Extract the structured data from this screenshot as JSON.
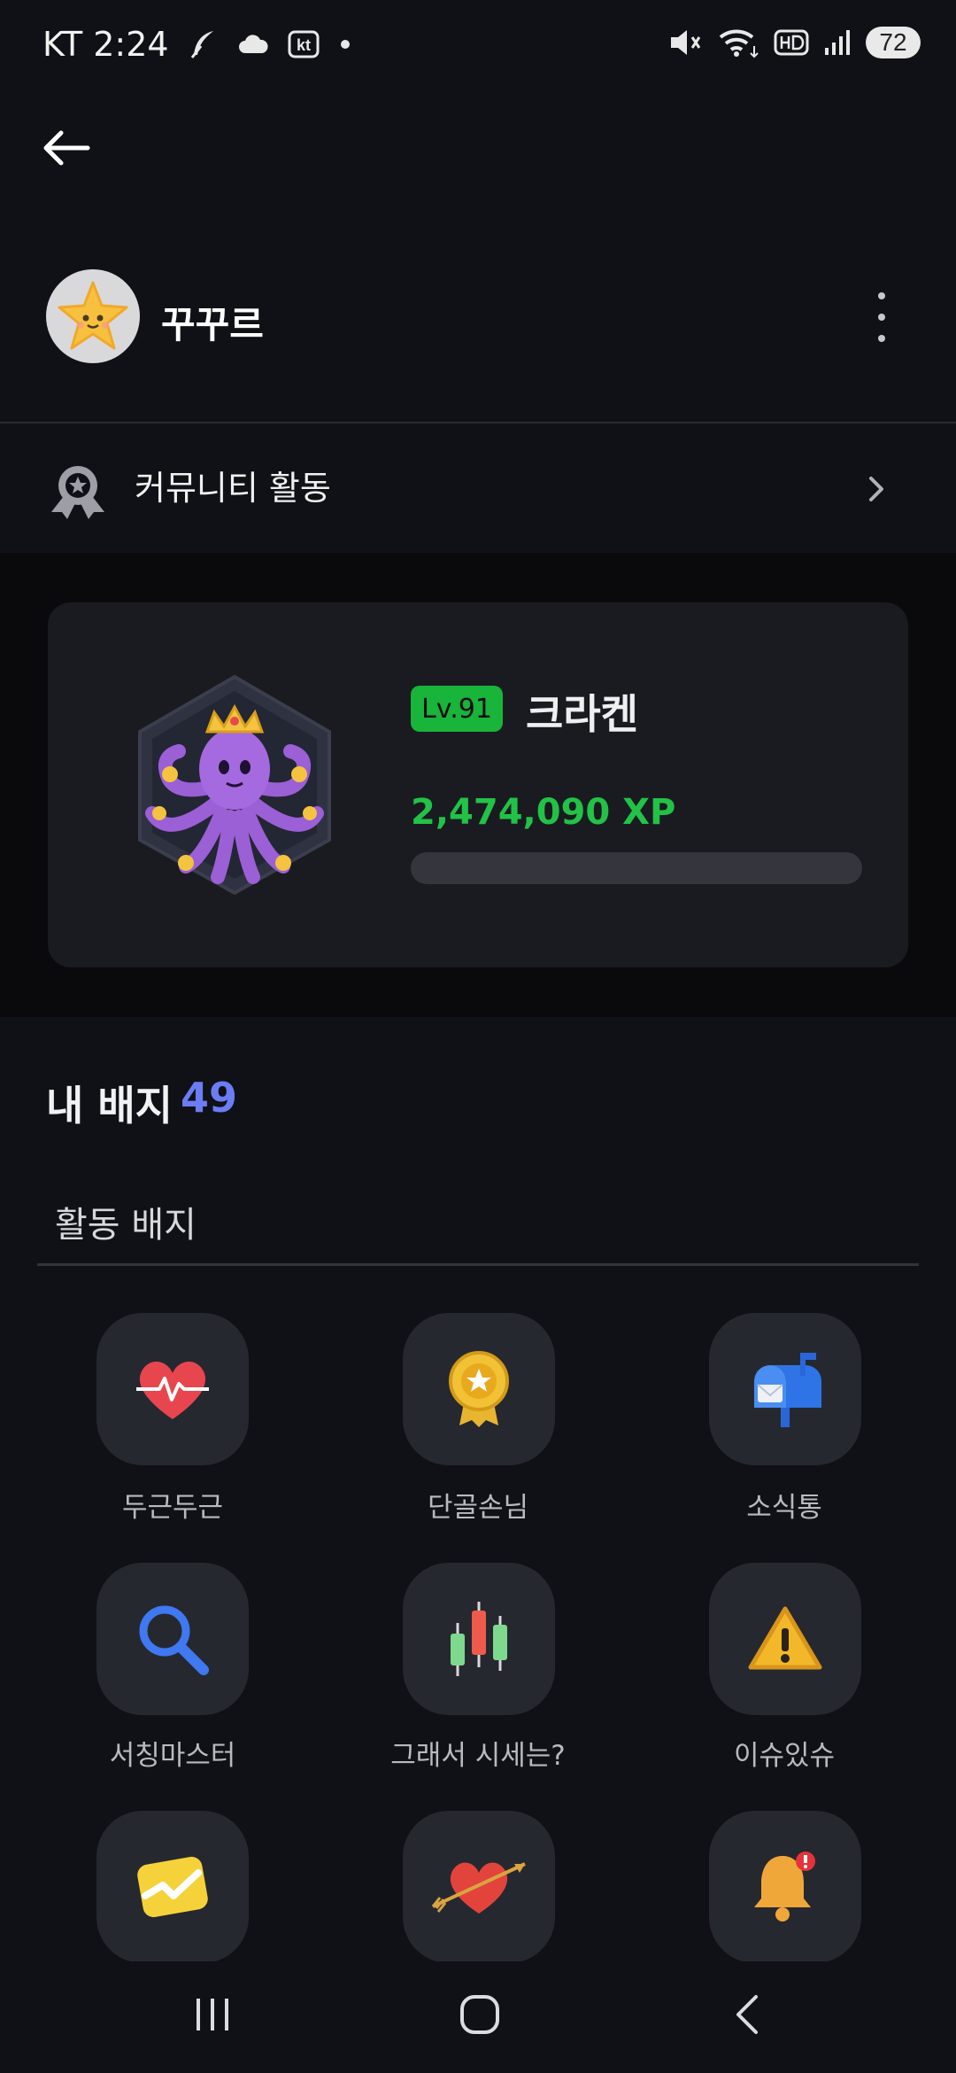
{
  "status_bar": {
    "carrier_time": "KT 2:24",
    "kt_mark": "kt",
    "battery": "72",
    "icons": [
      "feather-icon",
      "cloud-icon",
      "kt-icon",
      "dot-icon",
      "mute-icon",
      "wifi-icon",
      "hd-icon",
      "signal-icon",
      "battery-icon"
    ]
  },
  "header": {
    "back_icon": "arrow-left-icon"
  },
  "profile": {
    "nickname": "꾸꾸르",
    "avatar_icon": "star-face-icon"
  },
  "community": {
    "label": "커뮤니티 활동",
    "icon": "award-ribbon-icon"
  },
  "level": {
    "badge": "Lv.91",
    "name": "크라켄",
    "xp": "2,474,090 XP",
    "progress": 0,
    "image_icon": "kraken-octopus-icon"
  },
  "badges": {
    "title": "내 배지",
    "count": "49",
    "tab": "활동 배지",
    "items": [
      {
        "label": "두근두근",
        "icon": "heartbeat-icon"
      },
      {
        "label": "단골손님",
        "icon": "gold-medal-icon"
      },
      {
        "label": "소식통",
        "icon": "mailbox-icon"
      },
      {
        "label": "서칭마스터",
        "icon": "magnifier-icon"
      },
      {
        "label": "그래서 시세는?",
        "icon": "candlestick-icon"
      },
      {
        "label": "이슈있슈",
        "icon": "warning-icon"
      },
      {
        "label": "",
        "icon": "trend-chart-icon"
      },
      {
        "label": "",
        "icon": "heart-arrow-icon"
      },
      {
        "label": "",
        "icon": "bell-alert-icon"
      }
    ]
  },
  "navbar": {
    "icons": [
      "recent-apps-icon",
      "home-icon",
      "back-icon"
    ]
  },
  "colors": {
    "background": "#101116",
    "card": "#1a1b21",
    "accent_green": "#22c247",
    "accent_blue": "#6b7cf5"
  }
}
